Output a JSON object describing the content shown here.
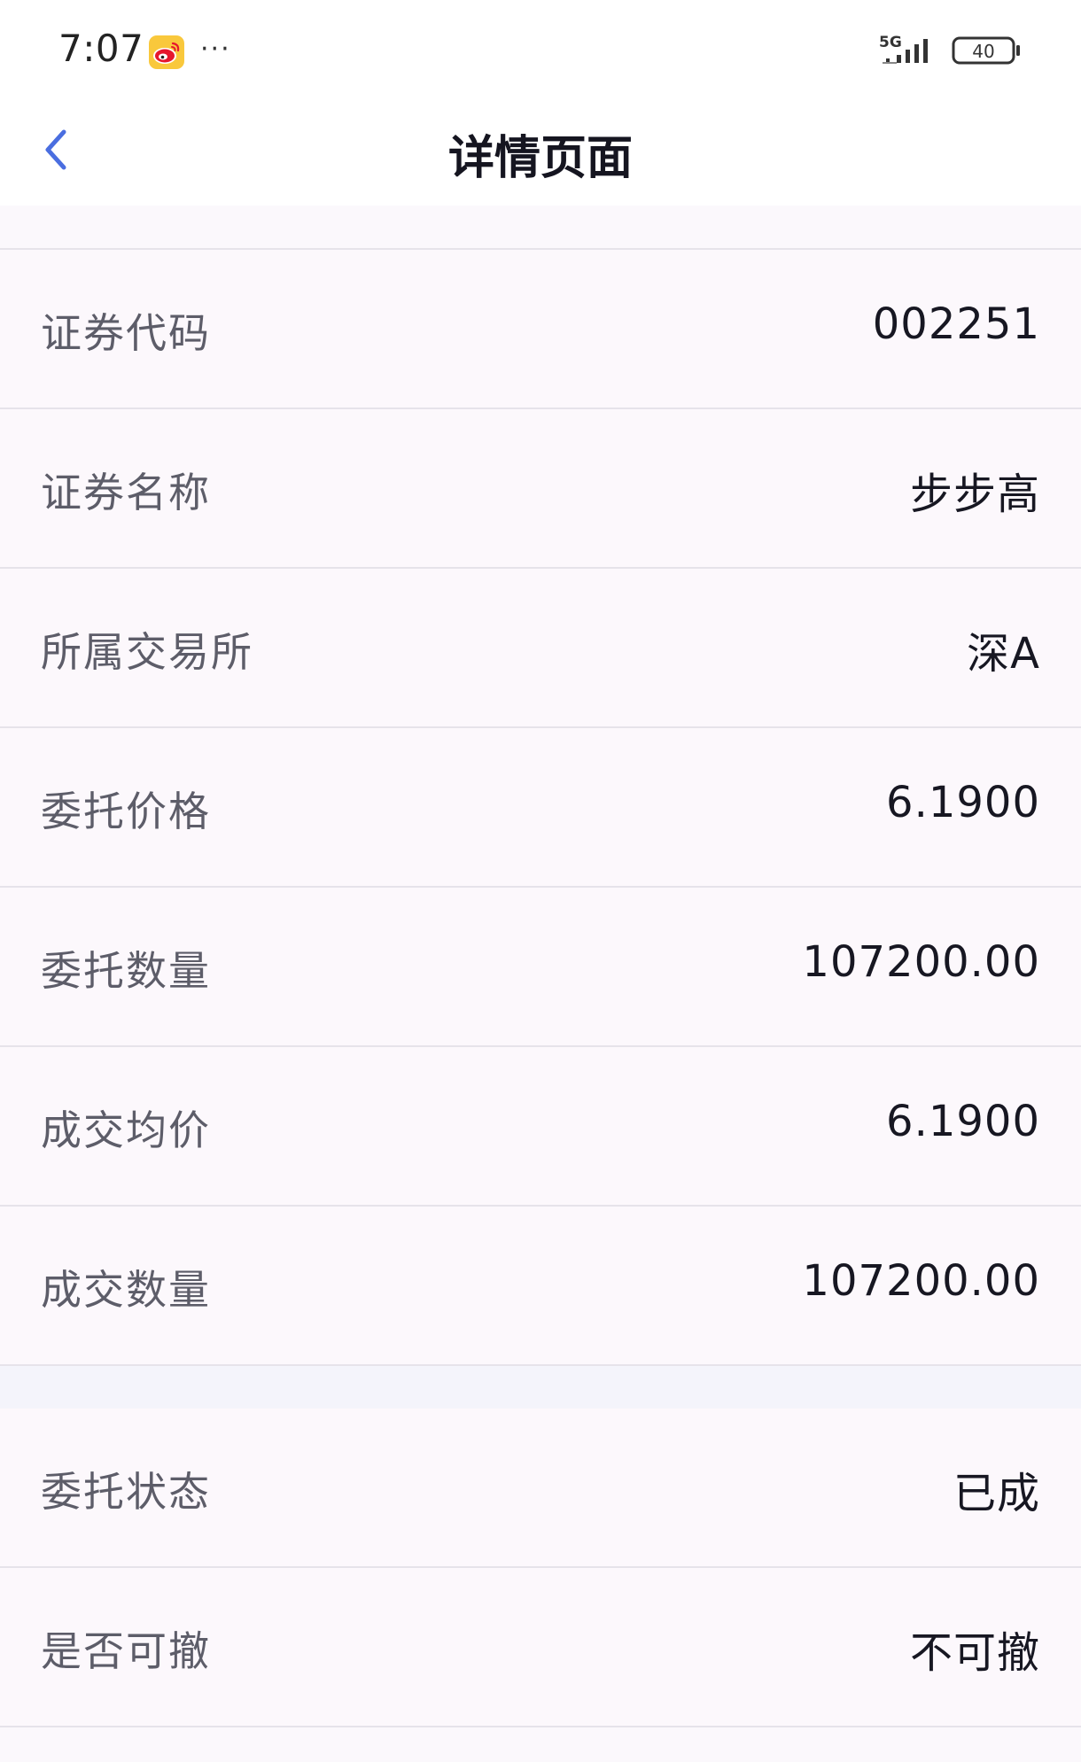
{
  "status_bar": {
    "time": "7:07",
    "more_dots": "···",
    "network": "5G",
    "battery_level": "40"
  },
  "header": {
    "title": "详情页面"
  },
  "details": [
    {
      "label": "证券代码",
      "value": "002251"
    },
    {
      "label": "证券名称",
      "value": "步步高"
    },
    {
      "label": "所属交易所",
      "value": "深A"
    },
    {
      "label": "委托价格",
      "value": "6.1900"
    },
    {
      "label": "委托数量",
      "value": "107200.00"
    },
    {
      "label": "成交均价",
      "value": "6.1900"
    },
    {
      "label": "成交数量",
      "value": "107200.00"
    }
  ],
  "status_details": [
    {
      "label": "委托状态",
      "value": "已成"
    },
    {
      "label": "是否可撤",
      "value": "不可撤"
    }
  ],
  "colors": {
    "accent": "#4a6ee0",
    "label": "#5d5d69",
    "value": "#171722"
  }
}
